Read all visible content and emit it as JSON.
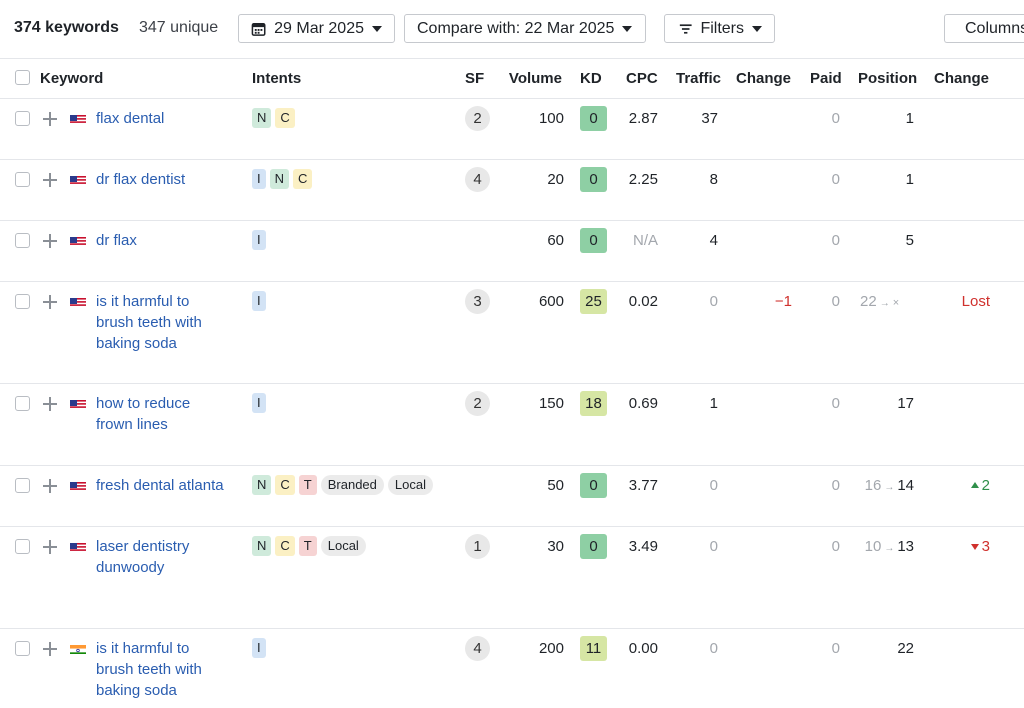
{
  "header": {
    "keywords_count": "374 keywords",
    "unique_count": "347 unique",
    "date_label": "29 Mar 2025",
    "compare_label": "Compare with: 22 Mar 2025",
    "filters_label": "Filters",
    "columns_label": "Columns"
  },
  "table": {
    "columns": {
      "keyword": "Keyword",
      "intents": "Intents",
      "sf": "SF",
      "volume": "Volume",
      "kd": "KD",
      "cpc": "CPC",
      "traffic": "Traffic",
      "change": "Change",
      "paid": "Paid",
      "position": "Position",
      "pos_change": "Change"
    },
    "rows": [
      {
        "keyword": "flax dental",
        "flag": "US",
        "intents": [
          "N",
          "C"
        ],
        "sf": "2",
        "volume": "100",
        "kd": "0",
        "cpc": "2.87",
        "traffic": "37",
        "change": "",
        "paid": "0",
        "pos_from": "",
        "pos_to": "1",
        "pos_change": ""
      },
      {
        "keyword": "dr flax dentist",
        "flag": "US",
        "intents": [
          "I",
          "N",
          "C"
        ],
        "sf": "4",
        "volume": "20",
        "kd": "0",
        "cpc": "2.25",
        "traffic": "8",
        "change": "",
        "paid": "0",
        "pos_from": "",
        "pos_to": "1",
        "pos_change": ""
      },
      {
        "keyword": "dr flax",
        "flag": "US",
        "intents": [
          "I"
        ],
        "sf": "",
        "volume": "60",
        "kd": "0",
        "cpc": "N/A",
        "traffic": "4",
        "change": "",
        "paid": "0",
        "pos_from": "",
        "pos_to": "5",
        "pos_change": ""
      },
      {
        "keyword": "is it harmful to brush teeth with baking soda",
        "flag": "US",
        "intents": [
          "I"
        ],
        "sf": "3",
        "volume": "600",
        "kd": "25",
        "cpc": "0.02",
        "traffic": "0",
        "change": "−1",
        "paid": "0",
        "pos_from": "22",
        "pos_to": "×",
        "pos_change": "Lost"
      },
      {
        "keyword": "how to reduce frown lines",
        "flag": "US",
        "intents": [
          "I"
        ],
        "sf": "2",
        "volume": "150",
        "kd": "18",
        "cpc": "0.69",
        "traffic": "1",
        "change": "",
        "paid": "0",
        "pos_from": "",
        "pos_to": "17",
        "pos_change": ""
      },
      {
        "keyword": "fresh dental atlanta",
        "flag": "US",
        "intents": [
          "N",
          "C",
          "T",
          "Branded",
          "Local"
        ],
        "sf": "",
        "volume": "50",
        "kd": "0",
        "cpc": "3.77",
        "traffic": "0",
        "change": "",
        "paid": "0",
        "pos_from": "16",
        "pos_to": "14",
        "pos_change": "2"
      },
      {
        "keyword": "laser dentistry dunwoody",
        "flag": "US",
        "intents": [
          "N",
          "C",
          "T",
          "Local"
        ],
        "sf": "1",
        "volume": "30",
        "kd": "0",
        "cpc": "3.49",
        "traffic": "0",
        "change": "",
        "paid": "0",
        "pos_from": "10",
        "pos_to": "13",
        "pos_change": "3"
      },
      {
        "keyword": "is it harmful to brush teeth with baking soda",
        "flag": "IN",
        "intents": [
          "I"
        ],
        "sf": "4",
        "volume": "200",
        "kd": "11",
        "cpc": "0.00",
        "traffic": "0",
        "change": "",
        "paid": "0",
        "pos_from": "",
        "pos_to": "22",
        "pos_change": ""
      }
    ]
  },
  "icons": {
    "calendar": "calendar-icon",
    "filter": "filter-icon",
    "columns": "columns-icon",
    "expand": "plus-icon",
    "dropdown": "chevron-down-icon"
  },
  "colors": {
    "link": "#2a5db0",
    "kd_easy": "#8ecfa4",
    "kd_medium": "#d6e6a4",
    "negative": "#d0312d",
    "positive": "#2f8f4a"
  }
}
